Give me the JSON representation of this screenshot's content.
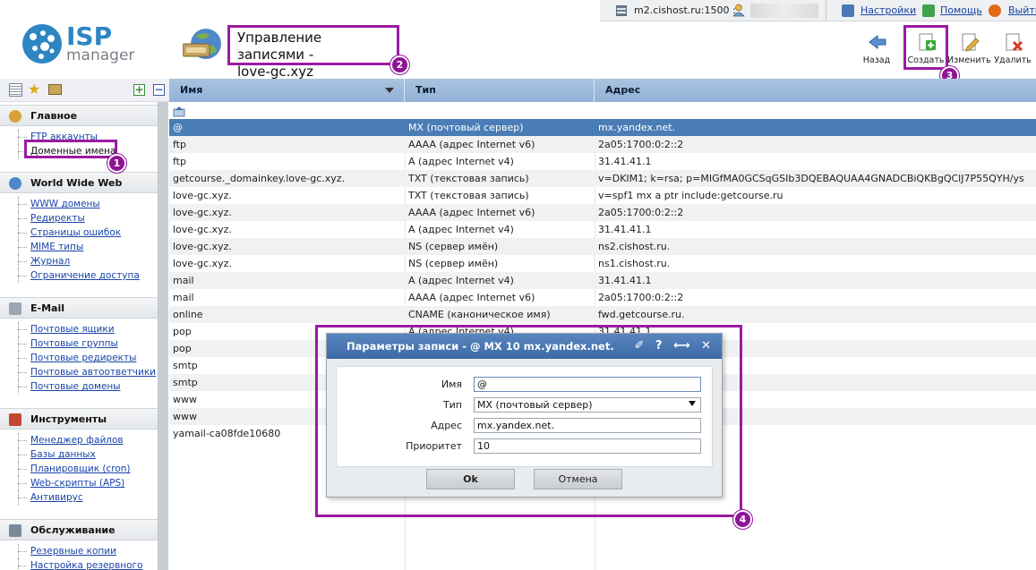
{
  "topbar": {
    "server": "m2.cishost.ru:1500 :",
    "settings": "Настройки",
    "help": "Помощь",
    "logout": "Выйти"
  },
  "logo": {
    "isp": "ISP",
    "manager": "manager"
  },
  "page": {
    "title_line1": "Управление записями -",
    "title_line2": "love-gc.xyz"
  },
  "markers": {
    "m1": "1",
    "m2": "2",
    "m3": "3",
    "m4": "4"
  },
  "toolbar": {
    "back": "Назад",
    "create": "Создать",
    "edit": "Изменить",
    "delete": "Удалить"
  },
  "sidebar": {
    "groups": [
      {
        "title": "Главное",
        "items": [
          "FTP аккаунты",
          "Доменные имена"
        ]
      },
      {
        "title": "World Wide Web",
        "items": [
          "WWW домены",
          "Редиректы",
          "Страницы ошибок",
          "MIME типы",
          "Журнал",
          "Ограничение доступа"
        ]
      },
      {
        "title": "E-Mail",
        "items": [
          "Почтовые ящики",
          "Почтовые группы",
          "Почтовые редиректы",
          "Почтовые автоответчики",
          "Почтовые домены"
        ]
      },
      {
        "title": "Инструменты",
        "items": [
          "Менеджер файлов",
          "Базы данных",
          "Планировщик (cron)",
          "Web-скрипты (APS)",
          "Антивирус"
        ]
      },
      {
        "title": "Обслуживание",
        "items": [
          "Резервные копии",
          "Настройка резервного"
        ]
      }
    ]
  },
  "table": {
    "columns": [
      "Имя",
      "Тип",
      "Адрес"
    ],
    "rows": [
      [
        "@",
        "MX (почтовый сервер)",
        "mx.yandex.net."
      ],
      [
        "ftp",
        "AAAA (адрес Internet v6)",
        "2a05:1700:0:2::2"
      ],
      [
        "ftp",
        "A (адрес Internet v4)",
        "31.41.41.1"
      ],
      [
        "getcourse._domainkey.love-gc.xyz.",
        "TXT (текстовая запись)",
        "v=DKIM1; k=rsa; p=MIGfMA0GCSqGSIb3DQEBAQUAA4GNADCBiQKBgQClJ7P55QYH/ys"
      ],
      [
        "love-gc.xyz.",
        "TXT (текстовая запись)",
        "v=spf1 mx a ptr include:getcourse.ru"
      ],
      [
        "love-gc.xyz.",
        "AAAA (адрес Internet v6)",
        "2a05:1700:0:2::2"
      ],
      [
        "love-gc.xyz.",
        "A (адрес Internet v4)",
        "31.41.41.1"
      ],
      [
        "love-gc.xyz.",
        "NS (сервер имён)",
        "ns2.cishost.ru."
      ],
      [
        "love-gc.xyz.",
        "NS (сервер имён)",
        "ns1.cishost.ru."
      ],
      [
        "mail",
        "A (адрес Internet v4)",
        "31.41.41.1"
      ],
      [
        "mail",
        "AAAA (адрес Internet v6)",
        "2a05:1700:0:2::2"
      ],
      [
        "online",
        "CNAME (каноническое имя)",
        "fwd.getcourse.ru."
      ],
      [
        "pop",
        "A (адрес Internet v4)",
        "31.41.41.1"
      ],
      [
        "pop",
        "",
        ""
      ],
      [
        "smtp",
        "",
        ""
      ],
      [
        "smtp",
        "",
        ""
      ],
      [
        "www",
        "",
        ""
      ],
      [
        "www",
        "",
        ""
      ],
      [
        "yamail-ca08fde10680",
        "",
        ""
      ]
    ]
  },
  "dialog": {
    "title": "Параметры записи - @ MX 10 mx.yandex.net.",
    "header_icons": "✐ ? ⟷ ✕",
    "fields": {
      "name_label": "Имя",
      "name_value": "@",
      "type_label": "Тип",
      "type_value": "MX (почтовый сервер)",
      "address_label": "Адрес",
      "address_value": "mx.yandex.net.",
      "priority_label": "Приоритет",
      "priority_value": "10"
    },
    "ok": "Ok",
    "cancel": "Отмена"
  }
}
